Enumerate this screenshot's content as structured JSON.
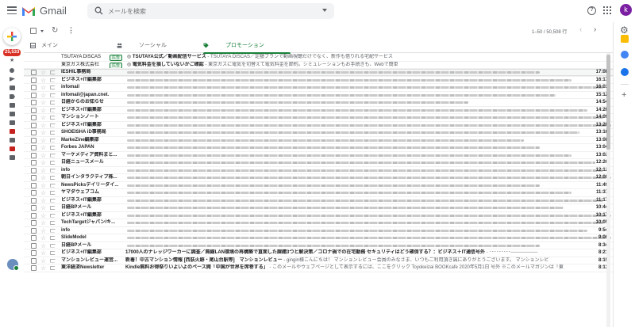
{
  "app": {
    "name": "Gmail",
    "avatar_letter": "k"
  },
  "search": {
    "placeholder": "メールを検索"
  },
  "sidebar": {
    "unread_count": "25,533"
  },
  "toolbar": {
    "pager": "1–50 / 50,508 行"
  },
  "tabs": [
    {
      "label": "メイン",
      "icon": "inbox-icon"
    },
    {
      "label": "ソーシャル",
      "icon": "people-icon"
    },
    {
      "label": "プロモーション",
      "icon": "tag-icon",
      "active": true
    }
  ],
  "colors": {
    "accent": "#188038",
    "gmail_red": "#ea4335",
    "avatar": "#7b1fa2"
  },
  "ads": [
    {
      "sender": "TSUTAYA DISCAS",
      "badge": "広告",
      "subject": "TSUTAYA公式／動画配信サービス",
      "snippet": " - TSUTAYA DISCAS／定額プランで動画視聴だけでなく、新作も借りれる宅配サービス"
    },
    {
      "sender": "東京ガス株式会社",
      "badge": "広告",
      "subject": "電気料金を損していないかご確認",
      "snippet": " - 東京ガスに電気を切替えて電気料金を節約。シミュレーションもお手続きも、Webで簡単"
    }
  ],
  "emails": [
    {
      "sender": "IESHIL事務局",
      "date": "17:08"
    },
    {
      "sender": "ビジネス+IT編集部",
      "date": "16:17"
    },
    {
      "sender": "infomail",
      "date": "16:03"
    },
    {
      "sender": "infomail@japan.cnet.",
      "date": "15:12"
    },
    {
      "sender": "日経からのお知らせ",
      "date": "14:54"
    },
    {
      "sender": "ビジネス+IT編集部",
      "date": "14:20"
    },
    {
      "sender": "マンションノート",
      "date": "14:09"
    },
    {
      "sender": "ビジネス+IT編集部",
      "date": "13:20"
    },
    {
      "sender": "SHOEISHA iD事務局",
      "date": "13:16"
    },
    {
      "sender": "MarkeZine編集部",
      "date": "13:08"
    },
    {
      "sender": "Forbes JAPAN",
      "date": "13:04"
    },
    {
      "sender": "マーケメディア資料まと...",
      "date": "13:02"
    },
    {
      "sender": "日経ニュースメール",
      "date": "12:26"
    },
    {
      "sender": "info",
      "date": "12:12"
    },
    {
      "sender": "朝日インタラクティブ株...",
      "date": "12:08"
    },
    {
      "sender": "NewsPicksデイリーダイ...",
      "date": "11:49"
    },
    {
      "sender": "ヤマダウェブコム",
      "date": "11:37"
    },
    {
      "sender": "ビジネス+IT編集部",
      "date": "11:17"
    },
    {
      "sender": "日経BPメール",
      "date": "10:44"
    },
    {
      "sender": "ビジネス+IT編集部",
      "date": "10:17"
    },
    {
      "sender": "TechTargetジャパン/キ...",
      "date": "10:05"
    },
    {
      "sender": "info",
      "date": "9:54"
    },
    {
      "sender": "SlideModel",
      "date": "9:06"
    },
    {
      "sender": "日経BPメール",
      "date": "8:34"
    },
    {
      "sender": "ビジネス+IT編集部",
      "subject": "17000人のナレッジワーカーに調査／無線LAN環境の再構築で直面した課題3つと解決策／コロナ禍での在宅勤務 セキュリティはどう確保する？：ビジネス＋IT通信号外",
      "snippet": " - ･････････────────",
      "date": "8:21"
    },
    {
      "sender": "マンションレビュー運営...",
      "subject": "新着！中古マンション情報 [西荻火跡・尾山台駅等]　マンションレビュー",
      "snippet": " - gingin様こんにちは！ マンションレビュー会員のみなさま、いつもご利用頂き誠にありがとうございます。 マンションレビ",
      "date": "8:15"
    },
    {
      "sender": "東洋経済Newsletter",
      "subject": "Kindle無料お得祭りいよいよのペース開「中国が世界を席巻する」",
      "snippet": " - このメールやウェブページとして表示するには、ここをクリック Toyokeizai BOOKcafe 2020年5月1日 号外 ※このメールマガジンは「東",
      "date": "8:13"
    }
  ]
}
